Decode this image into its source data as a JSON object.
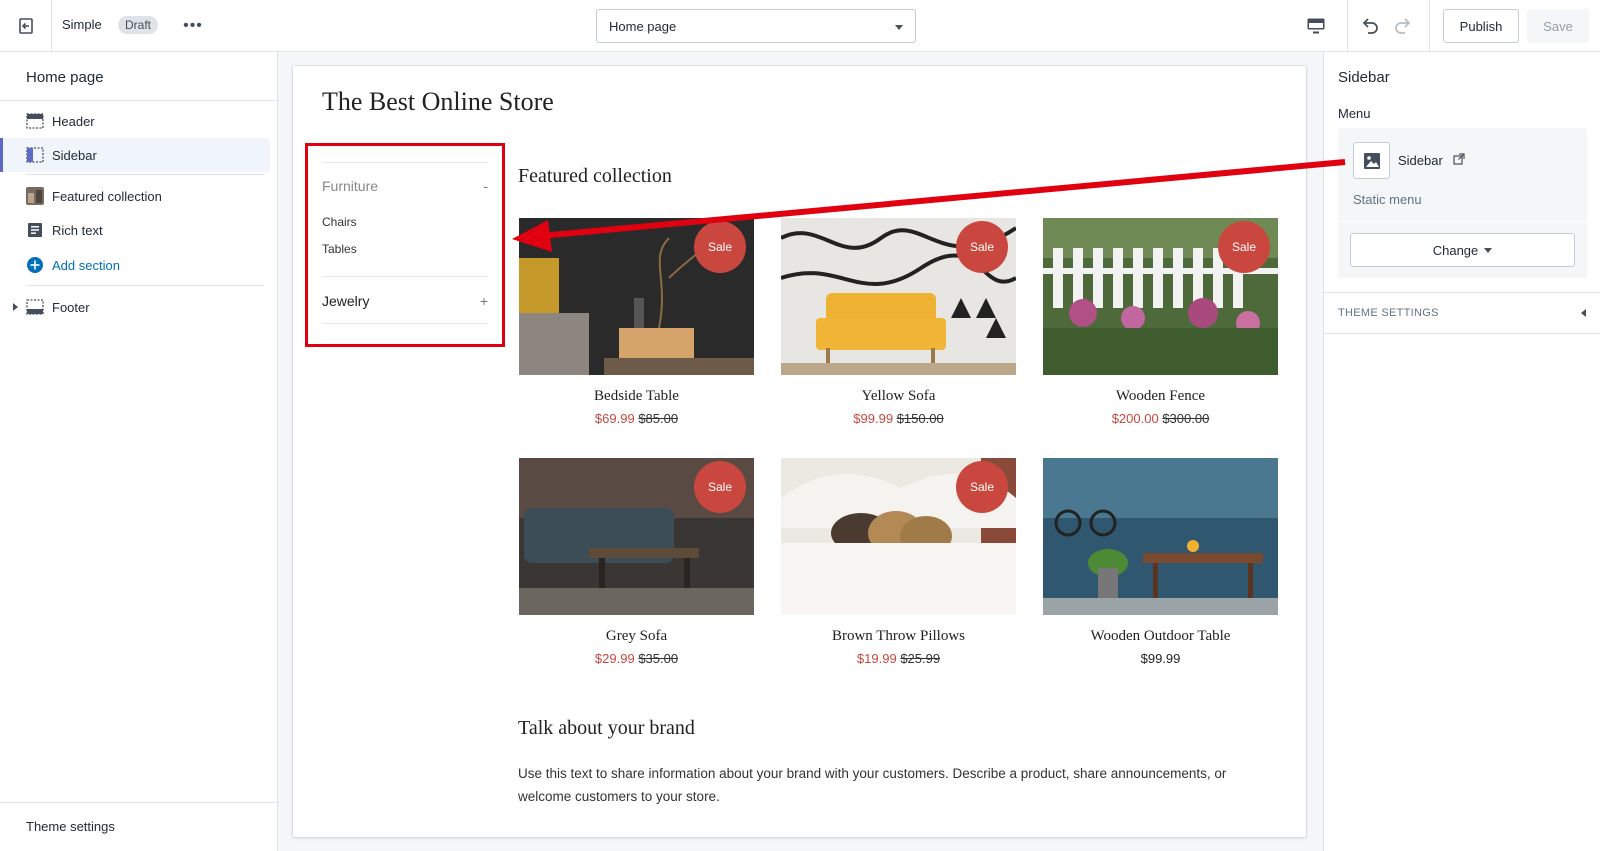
{
  "topbar": {
    "theme_name": "Simple",
    "badge": "Draft",
    "more_label": "•••",
    "page_selector_value": "Home page",
    "publish_label": "Publish",
    "save_label": "Save"
  },
  "left_panel": {
    "title": "Home page",
    "sections": [
      {
        "label": "Header",
        "icon": "header-section-icon"
      },
      {
        "label": "Sidebar",
        "icon": "sidebar-section-icon",
        "active": true
      },
      {
        "label": "Featured collection",
        "icon": "featured-collection-thumbnail"
      },
      {
        "label": "Rich text",
        "icon": "rich-text-icon"
      },
      {
        "label": "Add section",
        "icon": "plus-circle-icon"
      },
      {
        "label": "Footer",
        "icon": "footer-section-icon"
      }
    ],
    "theme_settings": "Theme settings"
  },
  "preview": {
    "store_title": "The Best Online Store",
    "side_menu": {
      "categories": [
        {
          "label": "Furniture",
          "toggle": "-",
          "items": [
            "Chairs",
            "Tables"
          ]
        },
        {
          "label": "Jewelry",
          "toggle": "+"
        }
      ]
    },
    "featured_title": "Featured collection",
    "products": [
      {
        "name": "Bedside Table",
        "sale_badge": "Sale",
        "price": "$69.99",
        "compare_price": "$85.00"
      },
      {
        "name": "Yellow Sofa",
        "sale_badge": "Sale",
        "price": "$99.99",
        "compare_price": "$150.00"
      },
      {
        "name": "Wooden Fence",
        "sale_badge": "Sale",
        "price": "$200.00",
        "compare_price": "$300.00"
      },
      {
        "name": "Grey Sofa",
        "sale_badge": "Sale",
        "price": "$29.99",
        "compare_price": "$35.00"
      },
      {
        "name": "Brown Throw Pillows",
        "sale_badge": "Sale",
        "price": "$19.99",
        "compare_price": "$25.99"
      },
      {
        "name": "Wooden Outdoor Table",
        "price": "$99.99"
      }
    ],
    "brand_title": "Talk about your brand",
    "brand_text": "Use this text to share information about your brand with your customers. Describe a product, share announcements, or welcome customers to your store."
  },
  "right_panel": {
    "title": "Sidebar",
    "menu_label": "Menu",
    "menu_name": "Sidebar",
    "menu_type": "Static menu",
    "change_label": "Change",
    "theme_settings_header": "THEME SETTINGS"
  },
  "colors": {
    "accent": "#5c6ac4",
    "sale": "#c9473f",
    "annotation": "#e0000f",
    "link": "#006fbb"
  }
}
